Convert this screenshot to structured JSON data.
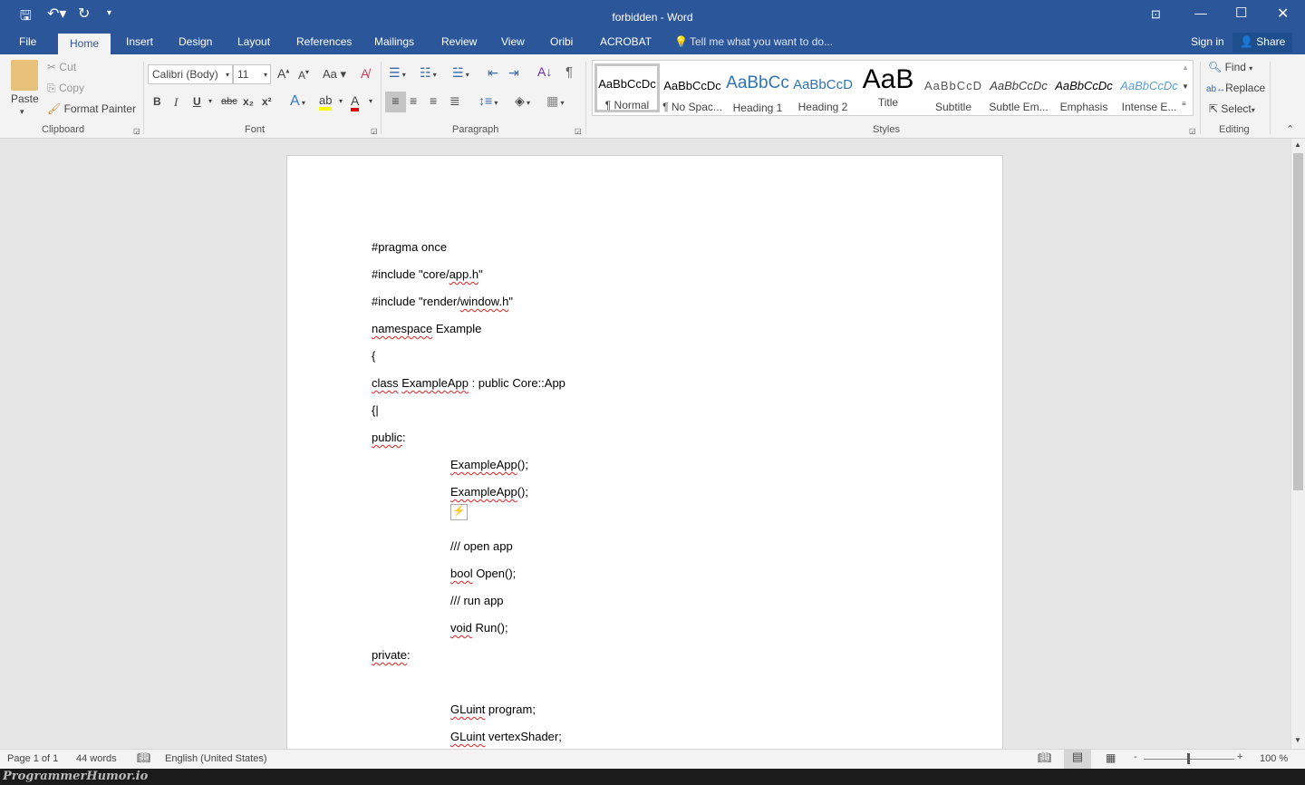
{
  "window": {
    "title": "forbidden - Word",
    "accent": "#2b579a"
  },
  "tabs": [
    {
      "label": "File"
    },
    {
      "label": "Home"
    },
    {
      "label": "Insert"
    },
    {
      "label": "Design"
    },
    {
      "label": "Layout"
    },
    {
      "label": "References"
    },
    {
      "label": "Mailings"
    },
    {
      "label": "Review"
    },
    {
      "label": "View"
    },
    {
      "label": "Oribi"
    },
    {
      "label": "ACROBAT"
    }
  ],
  "tell_me": "Tell me what you want to do...",
  "sign_in": "Sign in",
  "share": "Share",
  "clipboard": {
    "paste": "Paste",
    "cut": "Cut",
    "copy": "Copy",
    "format_painter": "Format Painter",
    "label": "Clipboard"
  },
  "font": {
    "name": "Calibri (Body)",
    "size": "11",
    "case": "Aa",
    "bold": "B",
    "italic": "I",
    "underline": "U",
    "strike": "abc",
    "sub": "x₂",
    "sup": "x²",
    "label": "Font"
  },
  "paragraph": {
    "label": "Paragraph"
  },
  "styles": {
    "label": "Styles",
    "items": [
      {
        "preview": "AaBbCcDc",
        "name": "¶ Normal"
      },
      {
        "preview": "AaBbCcDc",
        "name": "¶ No Spac..."
      },
      {
        "preview": "AaBbCc",
        "name": "Heading 1"
      },
      {
        "preview": "AaBbCcD",
        "name": "Heading 2"
      },
      {
        "preview": "AaB",
        "name": "Title"
      },
      {
        "preview": "AaBbCcD",
        "name": "Subtitle"
      },
      {
        "preview": "AaBbCcDc",
        "name": "Subtle Em..."
      },
      {
        "preview": "AaBbCcDc",
        "name": "Emphasis"
      },
      {
        "preview": "AaBbCcDc",
        "name": "Intense E..."
      }
    ]
  },
  "editing": {
    "find": "Find",
    "replace": "Replace",
    "select": "Select",
    "label": "Editing"
  },
  "document": {
    "lines": [
      {
        "indent": 0,
        "segs": [
          {
            "t": "#pragma once"
          }
        ]
      },
      {
        "indent": 0,
        "segs": [
          {
            "t": "#include \"core/"
          },
          {
            "t": "app.h",
            "sp": true
          },
          {
            "t": "\""
          }
        ]
      },
      {
        "indent": 0,
        "segs": [
          {
            "t": "#include \"render/"
          },
          {
            "t": "window.h",
            "sp": true
          },
          {
            "t": "\""
          }
        ]
      },
      {
        "indent": 0,
        "segs": [
          {
            "t": "namespace",
            "sp": true
          },
          {
            "t": " Example"
          }
        ]
      },
      {
        "indent": 0,
        "segs": [
          {
            "t": "{"
          }
        ]
      },
      {
        "indent": 0,
        "segs": [
          {
            "t": "class",
            "sp": true
          },
          {
            "t": " "
          },
          {
            "t": "ExampleApp",
            "sp": true
          },
          {
            "t": " : public Core::App"
          }
        ]
      },
      {
        "indent": 0,
        "segs": [
          {
            "t": "{|"
          }
        ]
      },
      {
        "indent": 0,
        "segs": [
          {
            "t": "public",
            "sp": true
          },
          {
            "t": ":"
          }
        ]
      },
      {
        "indent": 1,
        "segs": [
          {
            "t": "ExampleApp",
            "sp": true
          },
          {
            "t": "();"
          }
        ]
      },
      {
        "indent": 1,
        "segs": [
          {
            "t": "ExampleApp",
            "sp": true
          },
          {
            "t": "();"
          }
        ]
      },
      {
        "indent": 1,
        "segs": []
      },
      {
        "indent": 1,
        "segs": [
          {
            "t": "/// open app"
          }
        ]
      },
      {
        "indent": 1,
        "segs": [
          {
            "t": "bool",
            "sp": true
          },
          {
            "t": " Open();"
          }
        ]
      },
      {
        "indent": 1,
        "segs": [
          {
            "t": "/// run app"
          }
        ]
      },
      {
        "indent": 1,
        "segs": [
          {
            "t": "void",
            "sp": true
          },
          {
            "t": " Run();"
          }
        ]
      },
      {
        "indent": 0,
        "segs": [
          {
            "t": "private",
            "sp": true
          },
          {
            "t": ":"
          }
        ]
      },
      {
        "indent": 0,
        "segs": []
      },
      {
        "indent": 1,
        "segs": [
          {
            "t": "GLuint",
            "sp": true
          },
          {
            "t": " program;"
          }
        ]
      },
      {
        "indent": 1,
        "segs": [
          {
            "t": "GLuint",
            "sp": true
          },
          {
            "t": " vertexShader;"
          }
        ]
      }
    ]
  },
  "status": {
    "page": "Page 1 of 1",
    "words": "44 words",
    "language": "English (United States)",
    "zoom": "100 %",
    "zoom_level": 100
  },
  "watermark": "ProgrammerHumor.io"
}
